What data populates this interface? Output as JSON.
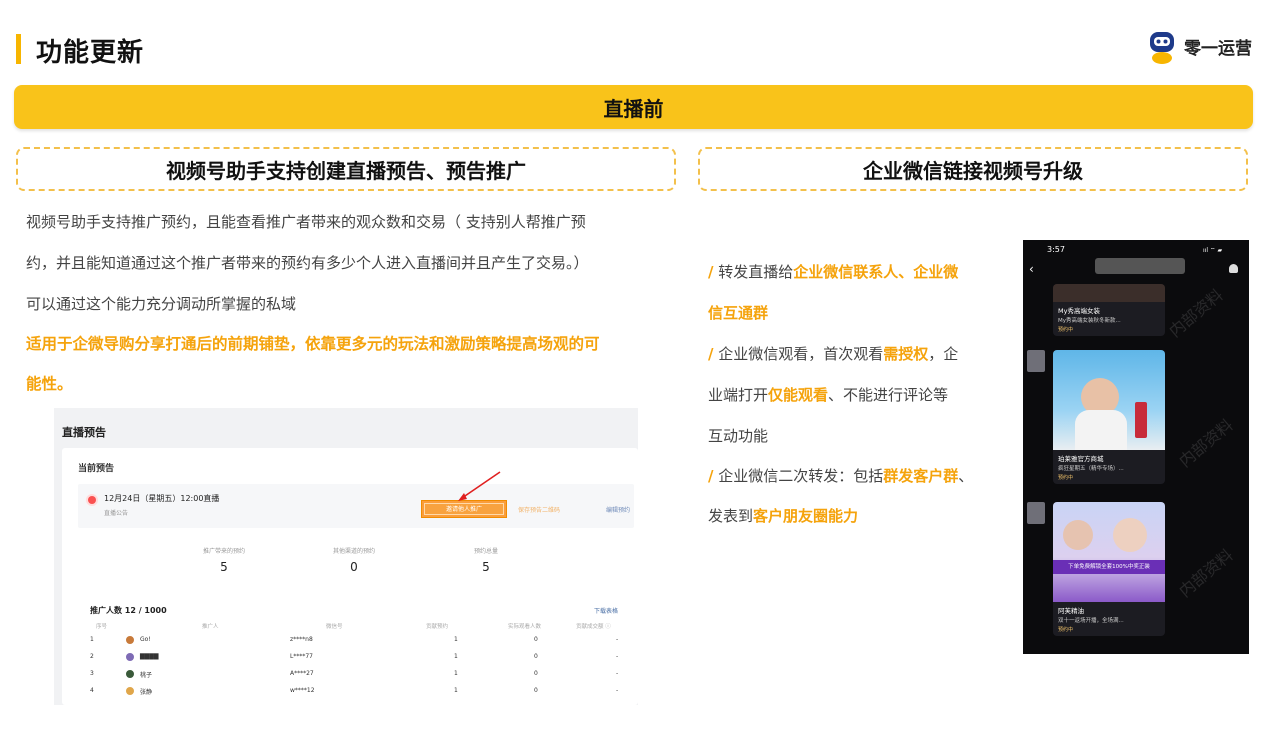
{
  "header": {
    "title": "功能更新"
  },
  "brand": {
    "name": "零一运营",
    "logo_icon": "robot-mascot-icon"
  },
  "banner": {
    "label": "直播前"
  },
  "left_section": {
    "title": "视频号助手支持创建直播预告、预告推广",
    "lines": [
      "视频号助手支持推广预约，且能查看推广者带来的观众数和交易（ 支持别人帮推广预",
      "约，并且能知道通过这个推广者带来的预约有多少个人进入直播间并且产生了交易。）",
      "可以通过这个能力充分调动所掌握的私域"
    ],
    "highlight_lines": [
      "适用于企微导购分享打通后的前期铺垫，依靠更多元的玩法和激励策略提高场观的可",
      "能性。"
    ]
  },
  "screenshot": {
    "header": "直播预告",
    "subheader": "当前预告",
    "live": {
      "date": "12月24日（星期五）12:00直播",
      "note": "直播公告"
    },
    "buttons": {
      "invite": "邀请他人推广",
      "save": "保存预告二维码",
      "edit": "编辑预约"
    },
    "stats": [
      {
        "label": "推广带来的预约",
        "value": "5"
      },
      {
        "label": "其他渠道的预约",
        "value": "0"
      },
      {
        "label": "预约总量",
        "value": "5"
      }
    ],
    "promo_count": "推广人数 12 / 1000",
    "download": "下载表格",
    "table": {
      "headers": [
        "序号",
        "推广人",
        "微信号",
        "贡献预约",
        "实际观看人数",
        "贡献成交额 ⓘ"
      ],
      "rows": [
        {
          "index": "1",
          "name": "Go!",
          "wechat": "z****n8",
          "reserve": "1",
          "watch": "0",
          "deal": "-",
          "avatar_color": "#c87a3a"
        },
        {
          "index": "2",
          "name": "▇▇▇▇",
          "wechat": "L****77",
          "reserve": "1",
          "watch": "0",
          "deal": "-",
          "avatar_color": "#7e6bb5"
        },
        {
          "index": "3",
          "name": "桃子",
          "wechat": "A****27",
          "reserve": "1",
          "watch": "0",
          "deal": "-",
          "avatar_color": "#3a5a3a"
        },
        {
          "index": "4",
          "name": "张静",
          "wechat": "w****12",
          "reserve": "1",
          "watch": "0",
          "deal": "-",
          "avatar_color": "#e0a64a"
        }
      ]
    }
  },
  "right_section": {
    "title": "企业微信链接视频号升级",
    "p1": {
      "slash": "/",
      "pre": " 转发直播给",
      "hl": "企业微信联系人、企业微",
      "hl2": "信互通群"
    },
    "p2": {
      "slash": "/",
      "pre": " 企业微信观看，首次观看",
      "hl": "需授权",
      "post": "，企",
      "line2_pre": "业端打开",
      "hl2": "仅能观看",
      "line2_post": "、不能进行评论等",
      "line3": "互动功能"
    },
    "p3": {
      "slash": "/",
      "pre": " 企业微信二次转发：包括",
      "hl": "群发客户群",
      "post": "、",
      "line2_pre": "发表到",
      "hl2": "客户朋友圈能力"
    }
  },
  "phone": {
    "time": "3:57",
    "status": "ııl ⌔ ▰",
    "back_icon": "‹",
    "cards": [
      {
        "shop": "My秀高端女装",
        "desc": "My秀高端女装秋冬新款...",
        "tag": "预约中"
      },
      {
        "shop": "珀莱雅官方商城",
        "desc": "疯狂星期五（精华专场）...",
        "tag": "预约中"
      },
      {
        "shop": "阿芙精油",
        "desc": "双十一返场开播，全场满...",
        "tag": "预约中"
      }
    ],
    "banner_text": "下单免费解锁全套100%中奖正装",
    "watermark": "内部资料"
  },
  "colors": {
    "accent": "#f5a30c",
    "banner": "#f9c31a",
    "dash": "#f3c04b"
  }
}
